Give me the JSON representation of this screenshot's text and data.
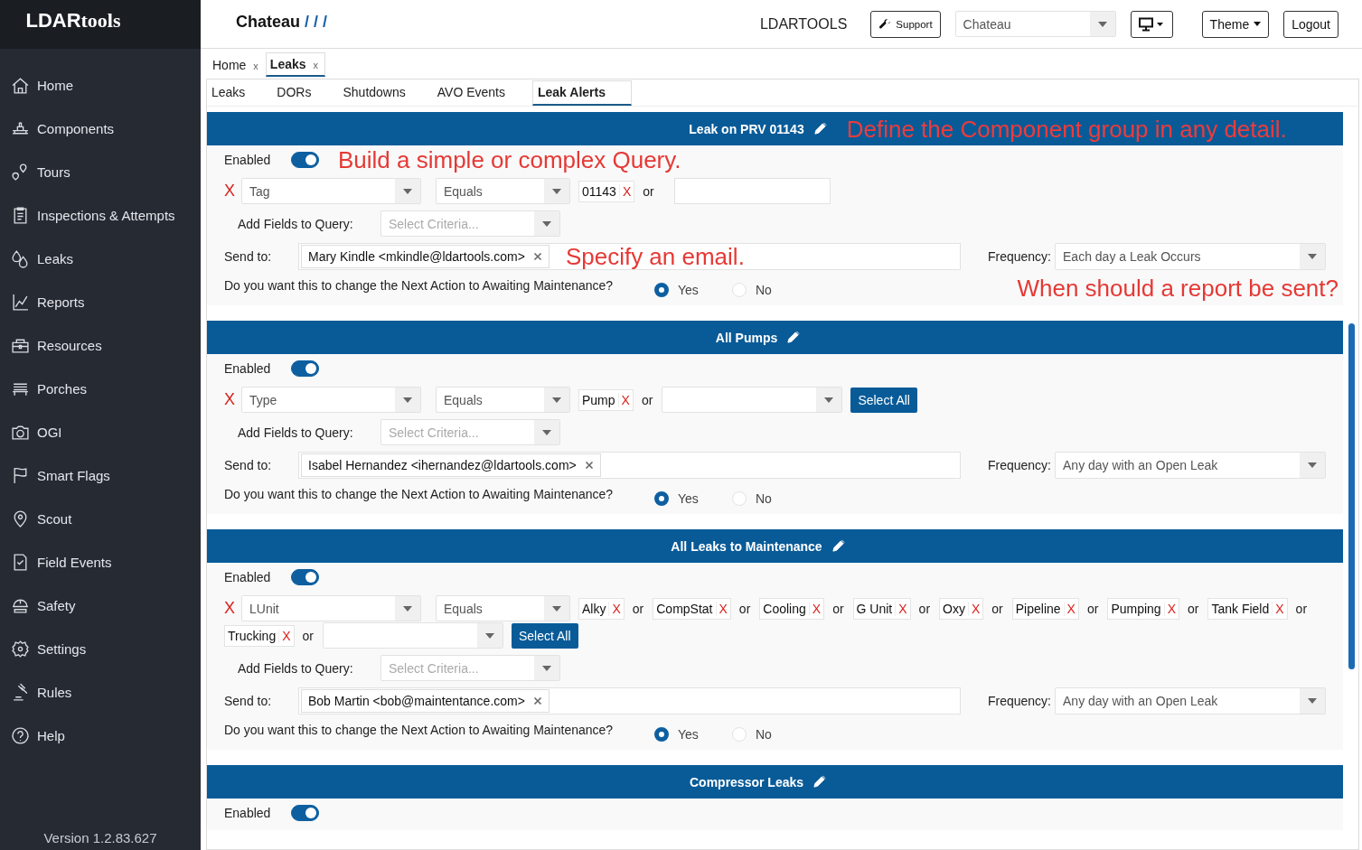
{
  "sidebar": {
    "logo": {
      "bold": "LDAR",
      "light": "tools"
    },
    "items": [
      {
        "label": "Home"
      },
      {
        "label": "Components"
      },
      {
        "label": "Tours"
      },
      {
        "label": "Inspections & Attempts"
      },
      {
        "label": "Leaks"
      },
      {
        "label": "Reports"
      },
      {
        "label": "Resources"
      },
      {
        "label": "Porches"
      },
      {
        "label": "OGI"
      },
      {
        "label": "Smart Flags"
      },
      {
        "label": "Scout"
      },
      {
        "label": "Field Events"
      },
      {
        "label": "Safety"
      },
      {
        "label": "Settings"
      },
      {
        "label": "Rules"
      },
      {
        "label": "Help"
      }
    ],
    "version": "Version 1.2.83.627"
  },
  "header": {
    "title": "Chateau",
    "separator": "/ / /",
    "brand": "LDARTOOLS",
    "support": "Support",
    "site": "Chateau",
    "theme": "Theme",
    "logout": "Logout"
  },
  "tabs": [
    {
      "label": "Home",
      "close": "x",
      "selected": false
    },
    {
      "label": "Leaks",
      "close": "x",
      "selected": true
    }
  ],
  "subtabs": [
    {
      "label": "Leaks",
      "selected": false
    },
    {
      "label": "DORs",
      "selected": false
    },
    {
      "label": "Shutdowns",
      "selected": false
    },
    {
      "label": "AVO Events",
      "selected": false
    },
    {
      "label": "Leak Alerts",
      "selected": true
    }
  ],
  "cards": [
    {
      "title": "Leak on PRV 01143",
      "enabled_label": "Enabled",
      "enabled": true,
      "query": {
        "remove": "X",
        "field": "Tag",
        "operator": "Equals",
        "values": [
          {
            "label": "01143",
            "remove": "X",
            "joiner": "or"
          }
        ],
        "extra": {
          "kind": "text"
        }
      },
      "add_fields_label": "Add Fields to Query:",
      "add_fields_placeholder": "Select Criteria...",
      "send_to_label": "Send to:",
      "recipients": [
        "Mary Kindle <mkindle@ldartools.com>"
      ],
      "frequency_label": "Frequency:",
      "frequency": "Each day a Leak Occurs",
      "question": "Do you want this to change the Next Action to Awaiting Maintenance?",
      "options": [
        {
          "label": "Yes",
          "selected": true
        },
        {
          "label": "No",
          "selected": false
        }
      ],
      "notes": {
        "header": "Define the Component group in any detail.",
        "enabled": "Build a simple or complex Query.",
        "send_to": "Specify an email.",
        "question": "When should a report be sent?"
      }
    },
    {
      "title": "All Pumps",
      "enabled_label": "Enabled",
      "enabled": true,
      "query": {
        "remove": "X",
        "field": "Type",
        "operator": "Equals",
        "values": [
          {
            "label": "Pump",
            "remove": "X",
            "joiner": "or"
          }
        ],
        "extra": {
          "kind": "select",
          "button": "Select All"
        }
      },
      "add_fields_label": "Add Fields to Query:",
      "add_fields_placeholder": "Select Criteria...",
      "send_to_label": "Send to:",
      "recipients": [
        "Isabel Hernandez <ihernandez@ldartools.com>"
      ],
      "frequency_label": "Frequency:",
      "frequency": "Any day with an Open Leak",
      "question": "Do you want this to change the Next Action to Awaiting Maintenance?",
      "options": [
        {
          "label": "Yes",
          "selected": true
        },
        {
          "label": "No",
          "selected": false
        }
      ]
    },
    {
      "title": "All Leaks to Maintenance",
      "enabled_label": "Enabled",
      "enabled": true,
      "query": {
        "remove": "X",
        "field": "LUnit",
        "operator": "Equals",
        "values": [
          {
            "label": "Alky",
            "remove": "X",
            "joiner": "or"
          },
          {
            "label": "CompStat",
            "remove": "X",
            "joiner": "or"
          },
          {
            "label": "Cooling",
            "remove": "X",
            "joiner": "or"
          },
          {
            "label": "G Unit",
            "remove": "X",
            "joiner": "or"
          },
          {
            "label": "Oxy",
            "remove": "X",
            "joiner": "or"
          },
          {
            "label": "Pipeline",
            "remove": "X",
            "joiner": "or"
          },
          {
            "label": "Pumping",
            "remove": "X",
            "joiner": "or"
          },
          {
            "label": "Tank Field",
            "remove": "X",
            "joiner": "or"
          },
          {
            "label": "Trucking",
            "remove": "X",
            "joiner": "or"
          }
        ],
        "extra": {
          "kind": "select",
          "button": "Select All"
        }
      },
      "add_fields_label": "Add Fields to Query:",
      "add_fields_placeholder": "Select Criteria...",
      "send_to_label": "Send to:",
      "recipients": [
        "Bob Martin <bob@maintentance.com>"
      ],
      "frequency_label": "Frequency:",
      "frequency": "Any day with an Open Leak",
      "question": "Do you want this to change the Next Action to Awaiting Maintenance?",
      "options": [
        {
          "label": "Yes",
          "selected": true
        },
        {
          "label": "No",
          "selected": false
        }
      ]
    },
    {
      "title": "Compressor Leaks",
      "enabled_label": "Enabled",
      "enabled": true
    }
  ]
}
